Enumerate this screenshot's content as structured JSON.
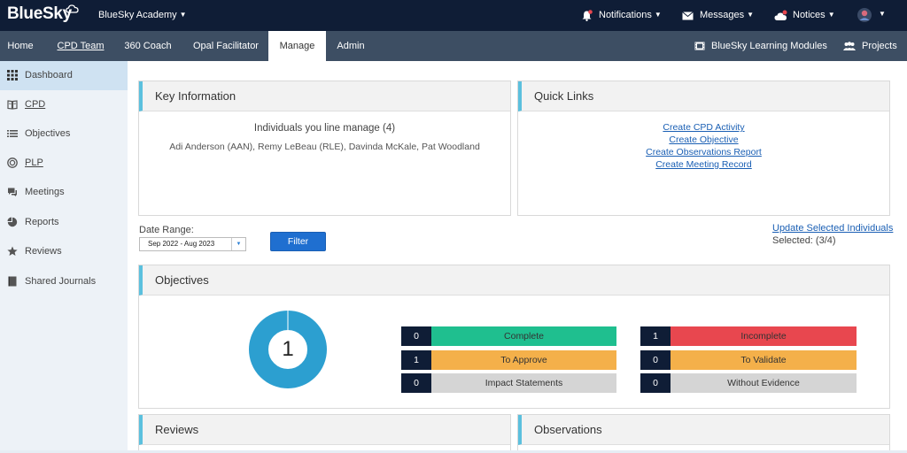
{
  "topbar": {
    "logo": "BlueSky",
    "academy": "BlueSky Academy",
    "notifications": "Notifications",
    "messages": "Messages",
    "notices": "Notices"
  },
  "nav": {
    "items": [
      "Home",
      "CPD Team",
      "360 Coach",
      "Opal Facilitator",
      "Manage",
      "Admin"
    ],
    "active": "Manage",
    "learning_modules": "BlueSky Learning Modules",
    "projects": "Projects"
  },
  "sidebar": {
    "items": [
      {
        "label": "Dashboard",
        "icon": "grid-icon"
      },
      {
        "label": "CPD",
        "icon": "book-icon"
      },
      {
        "label": "Objectives",
        "icon": "list-icon"
      },
      {
        "label": "PLP",
        "icon": "target-icon"
      },
      {
        "label": "Meetings",
        "icon": "chat-icon"
      },
      {
        "label": "Reports",
        "icon": "pie-icon"
      },
      {
        "label": "Reviews",
        "icon": "star-icon"
      },
      {
        "label": "Shared Journals",
        "icon": "journal-icon"
      }
    ]
  },
  "key_info": {
    "title": "Key Information",
    "heading": "Individuals you line manage (4)",
    "names": "Adi Anderson (AAN), Remy LeBeau (RLE), Davinda McKale, Pat Woodland"
  },
  "quick_links": {
    "title": "Quick Links",
    "links": [
      "Create CPD Activity",
      "Create Objective",
      "Create Observations Report",
      "Create Meeting Record"
    ]
  },
  "filter": {
    "date_label": "Date Range:",
    "date_value": "Sep 2022 - Aug 2023",
    "button": "Filter",
    "update_link": "Update Selected Individuals",
    "selected": "Selected: (3/4)"
  },
  "objectives": {
    "title": "Objectives",
    "total": "1",
    "counters": [
      {
        "count": "0",
        "label": "Complete",
        "color": "#1fbf8f"
      },
      {
        "count": "1",
        "label": "To Approve",
        "color": "#f4b04a"
      },
      {
        "count": "0",
        "label": "Impact Statements",
        "color": "#d5d5d5"
      },
      {
        "count": "1",
        "label": "Incomplete",
        "color": "#e8474f"
      },
      {
        "count": "0",
        "label": "To Validate",
        "color": "#f4b04a"
      },
      {
        "count": "0",
        "label": "Without Evidence",
        "color": "#d5d5d5"
      }
    ],
    "donut_color": "#2c9fd0"
  },
  "reviews": {
    "title": "Reviews"
  },
  "observations": {
    "title": "Observations"
  }
}
